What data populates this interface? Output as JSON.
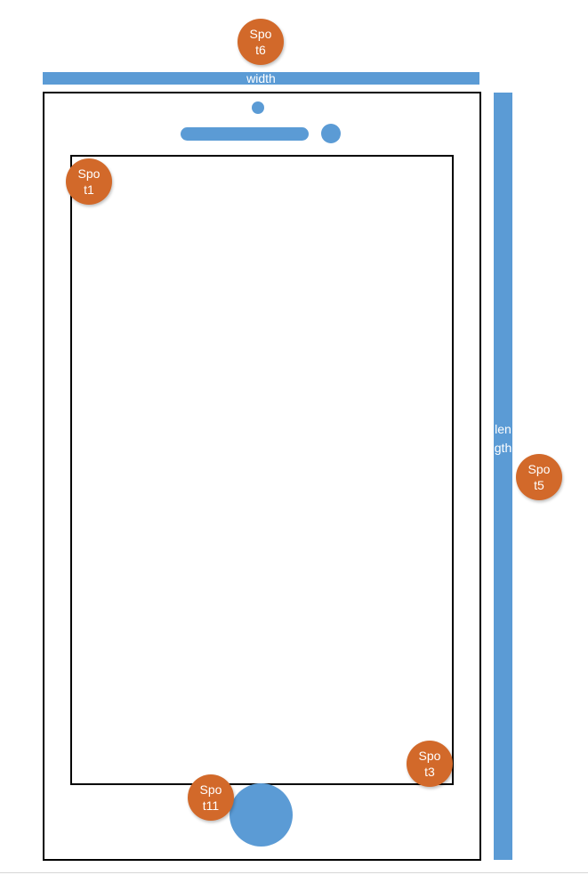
{
  "colors": {
    "accent_blue": "#5b9bd5",
    "spot_orange": "#d2692a",
    "outline": "#000000",
    "label_text": "#ffffff"
  },
  "labels": {
    "width": "width",
    "length": "length"
  },
  "spots": [
    {
      "line1": "Spo",
      "line2": "t6"
    },
    {
      "line1": "Spo",
      "line2": "t1"
    },
    {
      "line1": "Spo",
      "line2": "t5"
    },
    {
      "line1": "Spo",
      "line2": "t3"
    },
    {
      "line1": "Spo",
      "line2": "t11"
    }
  ]
}
